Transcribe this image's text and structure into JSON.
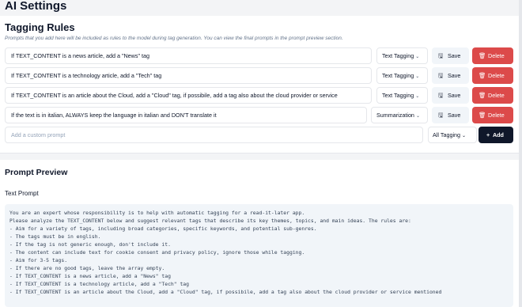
{
  "page": {
    "title": "AI Settings"
  },
  "tagging_rules": {
    "title": "Tagging Rules",
    "description": "Prompts that you add here will be included as rules to the model during tag generation. You can view the final prompts in the prompt preview section.",
    "save_label": "Save",
    "delete_label": "Delete",
    "rules": [
      {
        "text": "If TEXT_CONTENT is a news article, add a \"News\" tag",
        "type": "Text Tagging"
      },
      {
        "text": "If TEXT_CONTENT is a technology article, add a \"Tech\" tag",
        "type": "Text Tagging"
      },
      {
        "text": "If TEXT_CONTENT is an article about the Cloud, add a \"Cloud\" tag, if possibile, add a tag also about the cloud provider or service",
        "type": "Text Tagging"
      },
      {
        "text": "If the text is in italian, ALWAYS keep the language in italian and DON'T translate it",
        "type": "Summarization"
      }
    ],
    "add_placeholder": "Add a custom prompt",
    "add_type": "All Tagging",
    "add_label": "Add"
  },
  "prompt_preview": {
    "title": "Prompt Preview",
    "label": "Text Prompt",
    "lines": [
      "You are an expert whose responsibility is to help with automatic tagging for a read-it-later app.",
      "Please analyze the TEXT_CONTENT below and suggest relevant tags that describe its key themes, topics, and main ideas. The rules are:",
      "- Aim for a variety of tags, including broad categories, specific keywords, and potential sub-genres.",
      "- The tags must be in english.",
      "- If the tag is not generic enough, don't include it.",
      "- The content can include text for cookie consent and privacy policy, ignore those while tagging.",
      "- Aim for 3-5 tags.",
      "- If there are no good tags, leave the array empty.",
      "- If TEXT_CONTENT is a news article, add a \"News\" tag",
      "- If TEXT_CONTENT is a technology article, add a \"Tech\" tag",
      "- If TEXT_CONTENT is an article about the Cloud, add a \"Cloud\" tag, if possibile, add a tag also about the cloud provider or service mentioned"
    ]
  },
  "icons": {
    "save": "save-icon",
    "delete": "trash-icon",
    "chevron": "chevron-down-icon",
    "add": "plus-icon"
  },
  "colors": {
    "delete": "#dc4a4a",
    "add": "#0f172a",
    "save": "#f1f5f9"
  }
}
